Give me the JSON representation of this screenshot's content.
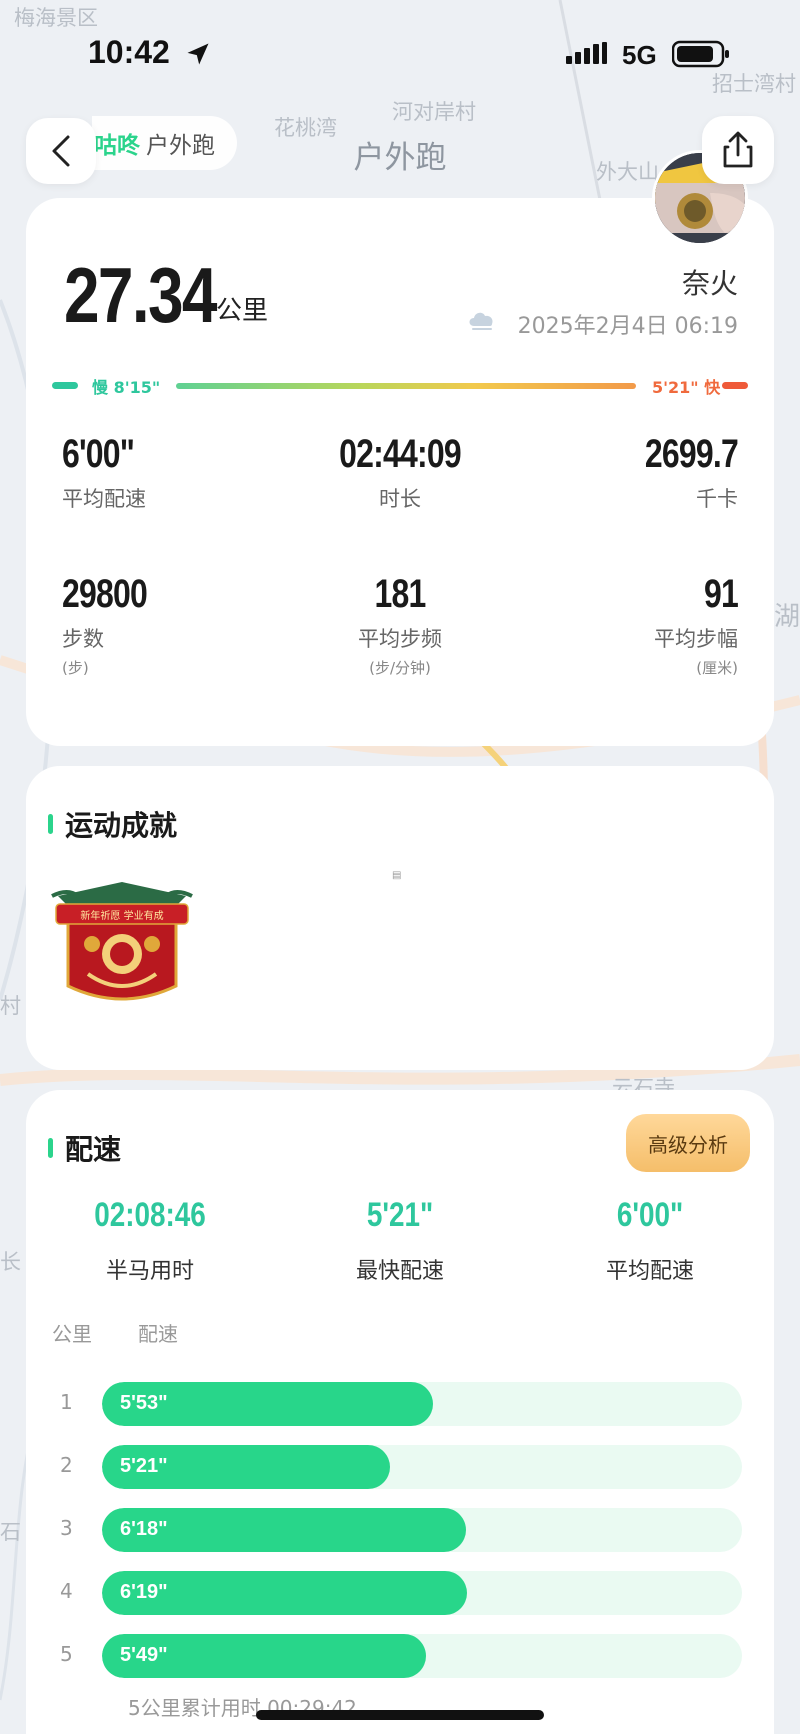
{
  "status_bar": {
    "time": "10:42",
    "network": "5G"
  },
  "map_labels": [
    "梅海景区",
    "花桃湾",
    "河对岸村",
    "招士湾村",
    "外大山",
    "湖",
    "石",
    "村",
    "长",
    "云石寺"
  ],
  "nav": {
    "brand_name": "咕咚",
    "brand_sub": "户外跑",
    "title": "户外跑",
    "back_icon": "chevron-left-icon",
    "share_icon": "share-icon"
  },
  "summary": {
    "distance": "27.34",
    "distance_unit": "公里",
    "runner_name": "奈火",
    "date": "2025年2月4日 06:19",
    "weather_icon": "cloudy-icon",
    "pace_scale": {
      "slow_label": "慢 8'15\"",
      "fast_label": "5'21\" 快"
    },
    "stats": [
      {
        "value": "6'00\"",
        "label": "平均配速",
        "unit": ""
      },
      {
        "value": "02:44:09",
        "label": "时长",
        "unit": ""
      },
      {
        "value": "2699.7",
        "label": "千卡",
        "unit": ""
      },
      {
        "value": "29800",
        "label": "步数",
        "unit": "(步)"
      },
      {
        "value": "181",
        "label": "平均步频",
        "unit": "(步/分钟)"
      },
      {
        "value": "91",
        "label": "平均步幅",
        "unit": "(厘米)"
      }
    ]
  },
  "achievements": {
    "title": "运动成就",
    "badge_text": "新年祈愿 学业有成"
  },
  "pace": {
    "title": "配速",
    "advanced_button": "高级分析",
    "summary": [
      {
        "value": "02:08:46",
        "label": "半马用时"
      },
      {
        "value": "5'21\"",
        "label": "最快配速"
      },
      {
        "value": "6'00\"",
        "label": "平均配速"
      }
    ],
    "col_km": "公里",
    "col_pace": "配速",
    "splits": [
      {
        "km": "1",
        "pace": "5'53\"",
        "fill": 0.517
      },
      {
        "km": "2",
        "pace": "5'21\"",
        "fill": 0.45
      },
      {
        "km": "3",
        "pace": "6'18\"",
        "fill": 0.569
      },
      {
        "km": "4",
        "pace": "6'19\"",
        "fill": 0.57
      },
      {
        "km": "5",
        "pace": "5'49\"",
        "fill": 0.507
      }
    ],
    "cumulative": "5公里累计用时 00:29:42"
  },
  "colors": {
    "accent": "#2bd48c",
    "pace_fill": "#28d68a",
    "fast": "#ef5a39"
  }
}
